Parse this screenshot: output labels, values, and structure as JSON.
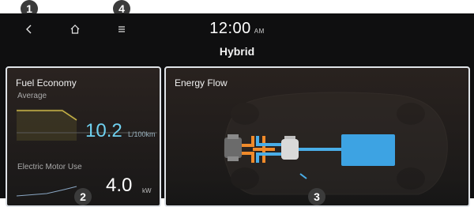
{
  "topbar": {
    "back_icon": "chevron-left-icon",
    "home_icon": "home-icon",
    "menu_icon": "menu-icon",
    "time": "12:00",
    "ampm": "AM",
    "mode_title": "Hybrid"
  },
  "fuel_economy": {
    "title": "Fuel Economy",
    "average_label": "Average",
    "average_value": "10.2",
    "average_unit": "L/100km",
    "motor_label": "Electric Motor Use",
    "motor_value": "4.0",
    "motor_unit": "kW"
  },
  "energy_flow": {
    "title": "Energy Flow"
  },
  "callouts": {
    "one": "1",
    "two": "2",
    "three": "3",
    "four": "4"
  },
  "colors": {
    "accent_blue": "#4aaee8",
    "accent_orange": "#f08a2a",
    "value_cyan": "#6fd0ef",
    "panel_border": "#dfe3e8",
    "graph_yellow": "#c9b447"
  }
}
